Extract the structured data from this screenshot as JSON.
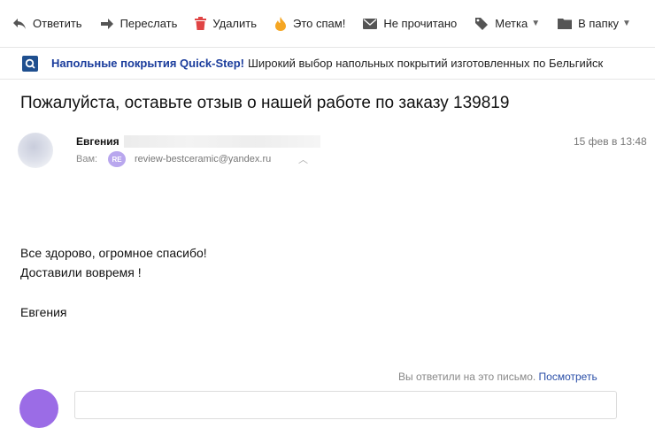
{
  "toolbar": {
    "reply": "Ответить",
    "forward": "Переслать",
    "delete": "Удалить",
    "spam": "Это спам!",
    "unread": "Не прочитано",
    "label": "Метка",
    "folder": "В папку"
  },
  "ad": {
    "title": "Напольные покрытия Quick-Step!",
    "text": "Широкий выбор напольных покрытий изготовленных по Бельгийск",
    "logo_letter": "Q"
  },
  "message": {
    "subject": "Пожалуйста, оставьте отзыв о нашей работе по заказу 139819",
    "sender_name": "Евгения",
    "date": "15 фев в 13:48",
    "to_label": "Вам:",
    "to_badge": "RE",
    "to_email": "review-bestceramic@yandex.ru",
    "body_lines": [
      "Все здорово, огромное спасибо!",
      "Доставили вовремя !",
      "Евгения"
    ]
  },
  "reply_notice": {
    "text": "Вы ответили на это письмо.",
    "link": "Посмотреть"
  },
  "colors": {
    "accent_link": "#2b4fa8",
    "ad_title": "#1a3c9c",
    "badge": "#b9a7ee",
    "avatar": "#9b6ce6",
    "delete_icon": "#e04444",
    "spam_icon": "#f5a623"
  }
}
